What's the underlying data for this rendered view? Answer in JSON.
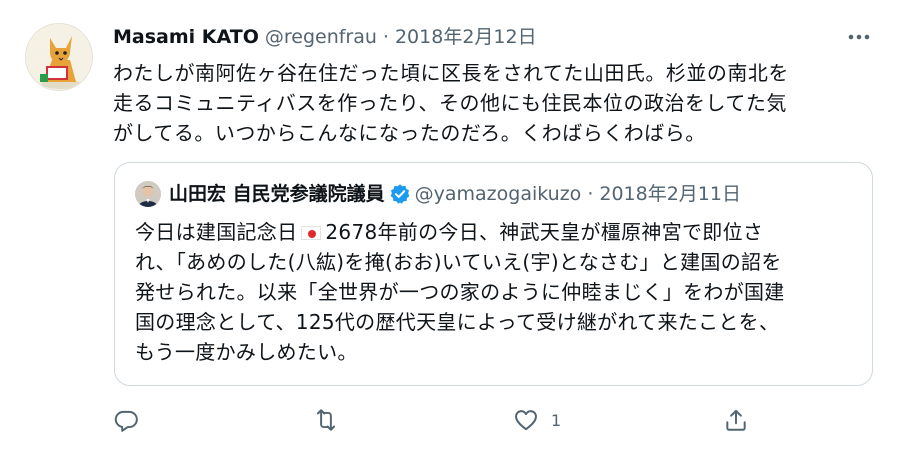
{
  "tweet": {
    "display_name": "Masami KATO",
    "handle": "@regenfrau",
    "separator": "·",
    "date": "2018年2月12日",
    "body_lines": [
      "わたしが南阿佐ヶ谷在住だった頃に区長をされてた山田氏。杉並の南北を",
      "走るコミュニティバスを作ったり、その他にも住民本位の政治をしてた気",
      "がしてる。いつからこんなになったのだろ。くわばらくわばら。"
    ]
  },
  "quote": {
    "display_name": "山田宏 自民党参議院議員",
    "handle": "@yamazogaikuzo",
    "separator": "·",
    "date": "2018年2月11日",
    "line1_pre": "今日は建国記念日",
    "line1_post": "2678年前の今日、神武天皇が橿原神宮で即位さ",
    "lines": [
      "れ、「あめのした(八紘)を掩(おお)いていえ(宇)となさむ」と建国の詔を",
      "発せられた。以来「全世界が一つの家のように仲睦まじく」をわが国建",
      "国の理念として、125代の歴代天皇によって受け継がれて来たことを、",
      "もう一度かみしめたい。"
    ]
  },
  "actions": {
    "like_count": "1"
  },
  "icons": {
    "more": "more-horizontal-icon",
    "verified": "verified-badge-icon",
    "flag": "japan-flag-icon",
    "reply": "reply-icon",
    "retweet": "retweet-icon",
    "like": "heart-icon",
    "share": "share-icon"
  },
  "colors": {
    "verified_blue": "#1d9bf0",
    "secondary_text": "#536471",
    "border": "#cfd9de"
  }
}
